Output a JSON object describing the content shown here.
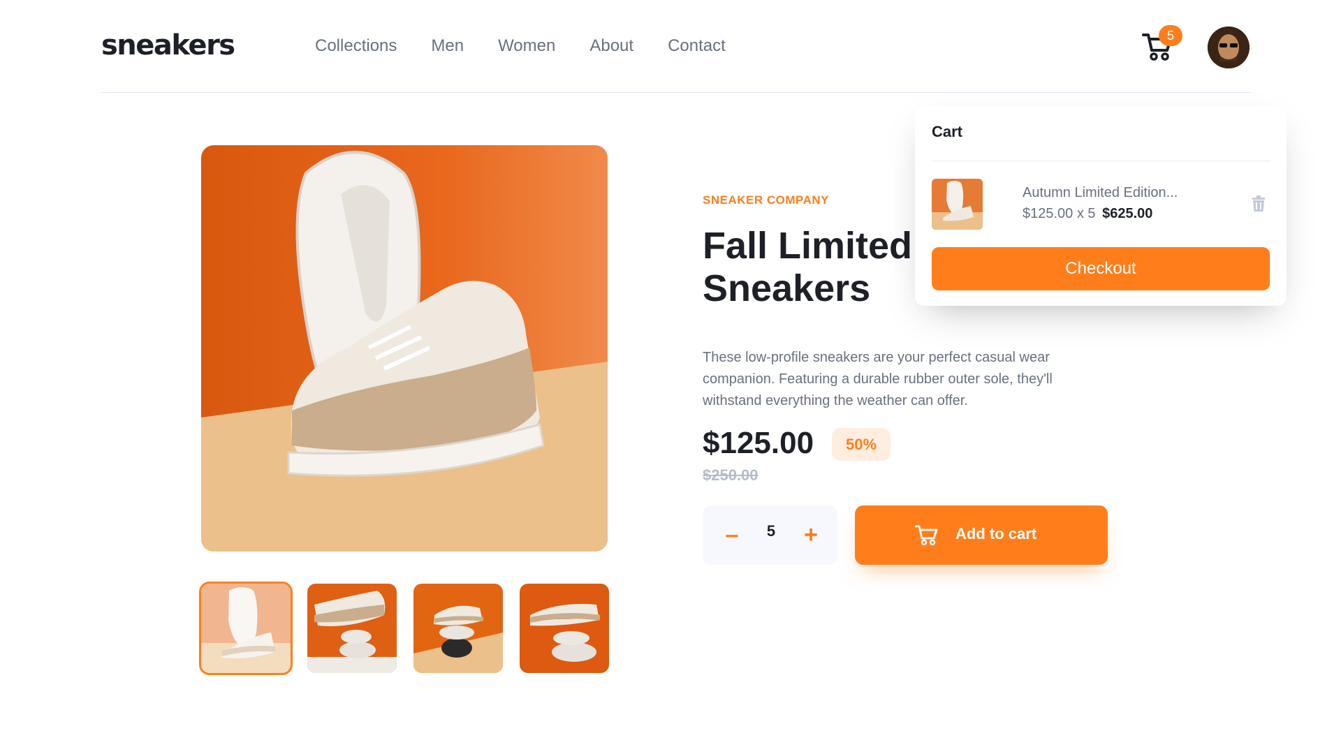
{
  "header": {
    "logo": "sneakers",
    "nav": [
      "Collections",
      "Men",
      "Women",
      "About",
      "Contact"
    ],
    "cart_count": "5",
    "cart_icon": "cart-icon",
    "avatar_icon": "avatar"
  },
  "product": {
    "company": "SNEAKER COMPANY",
    "title": "Fall Limited Edition Sneakers",
    "description": "These low-profile sneakers are your perfect casual wear companion. Featuring a durable rubber outer sole, they'll withstand everything the weather can offer.",
    "price": "$125.00",
    "discount": "50%",
    "old_price": "$250.00",
    "quantity": "5",
    "minus_label": "–",
    "plus_label": "+",
    "add_to_cart": "Add to cart"
  },
  "cart": {
    "title": "Cart",
    "item_name": "Autumn Limited Edition...",
    "item_unit": "$125.00 x 5",
    "item_total": "$625.00",
    "checkout": "Checkout"
  },
  "colors": {
    "accent": "#ff7e1b",
    "accent_pale": "#ffede0",
    "text_dark": "#1d2026",
    "text_grey": "#69707d"
  }
}
